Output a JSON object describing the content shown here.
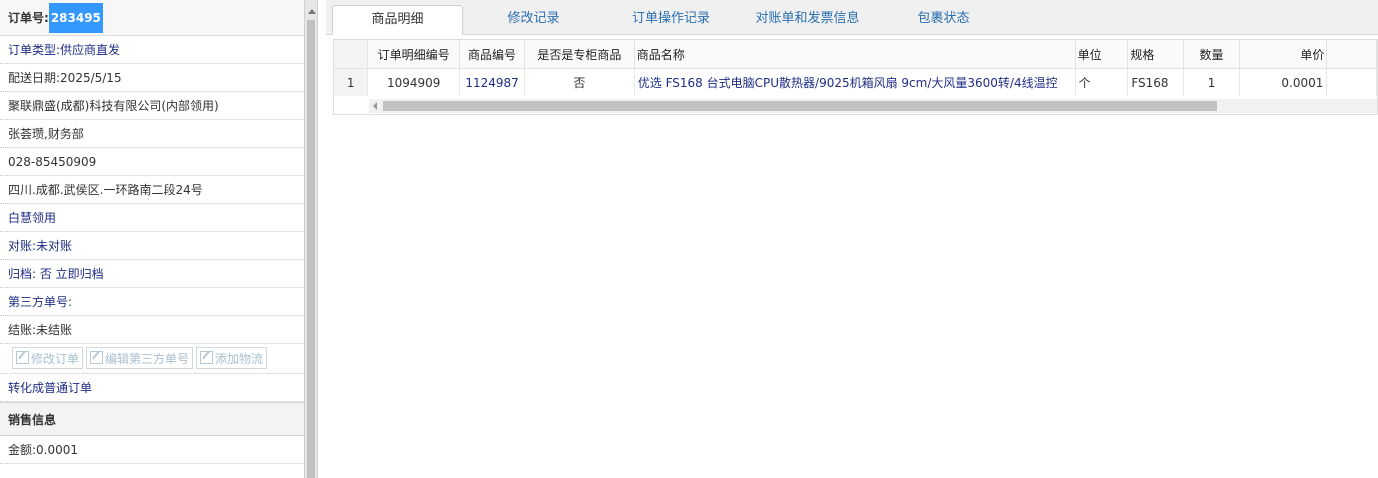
{
  "order": {
    "number_label": "订单号:",
    "number": "283495",
    "type": "订单类型:供应商直发",
    "delivery_date": "配送日期:2025/5/15",
    "company": "聚联鼎盛(成都)科技有限公司(内部领用)",
    "contact": "张荟瓒,财务部",
    "phone": "028-85450909",
    "address": "四川.成都.武侯区.一环路南二段24号",
    "usage": "白慧领用",
    "reconcile": "对账:未对账",
    "archive": "归档: 否 立即归档",
    "third_party_no": "第三方单号:",
    "settlement": "结账:未结账",
    "buttons": {
      "edit_order": "修改订单",
      "edit_third_party": "编辑第三方单号",
      "add_logistics": "添加物流"
    },
    "convert": "转化成普通订单",
    "sales_section": "销售信息",
    "amount": "金额:0.0001"
  },
  "tabs": [
    {
      "label": "商品明细",
      "active": true
    },
    {
      "label": "修改记录",
      "active": false
    },
    {
      "label": "订单操作记录",
      "active": false
    },
    {
      "label": "对账单和发票信息",
      "active": false
    },
    {
      "label": "包裹状态",
      "active": false
    }
  ],
  "table": {
    "headers": [
      "",
      "订单明细编号",
      "商品编号",
      "是否是专柜商品",
      "商品名称",
      "单位",
      "规格",
      "数量",
      "单价"
    ],
    "rows": [
      [
        "1",
        "1094909",
        "1124987",
        "否",
        "优选 FS168 台式电脑CPU散热器/9025机箱风扇 9cm/大风量3600转/4线温控",
        "个",
        "FS168",
        "1",
        "0.0001"
      ]
    ]
  },
  "colors": {
    "highlight": "#3399ff",
    "link": "#1f2d86",
    "tab_text": "#2a6fb0"
  }
}
